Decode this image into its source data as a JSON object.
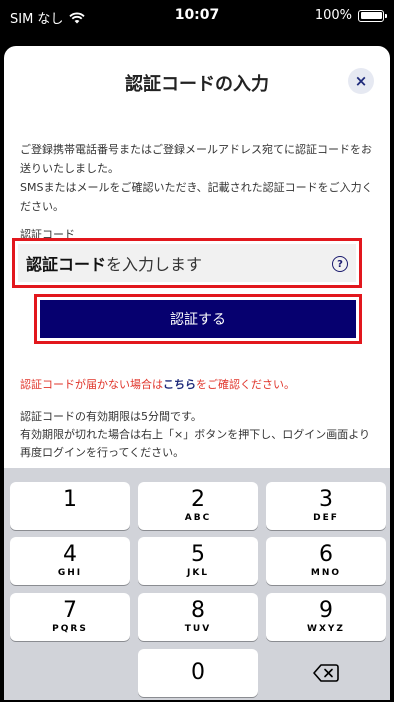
{
  "status_bar": {
    "carrier": "SIM なし",
    "time": "10:07",
    "battery": "100%"
  },
  "sheet": {
    "title": "認証コードの入力",
    "close_label": "×",
    "description_line1": "ご登録携帯電話番号またはご登録メールアドレス宛てに認証コードをお送りいたしました。",
    "description_line2": "SMSまたはメールをご確認いただき、記載された認証コードをご入力ください。",
    "field_label": "認証コード",
    "input_placeholder_bold": "認証コード",
    "input_placeholder_rest": "を入力します",
    "help_label": "?",
    "submit_label": "認証する",
    "not_arrived_prefix": "認証コードが届かない場合は",
    "not_arrived_link": "こちら",
    "not_arrived_suffix": "をご確認ください。",
    "validity_line1": "認証コードの有効期限は5分間です。",
    "validity_line2": "有効期限が切れた場合は右上「×」ボタンを押下し、ログイン画面より再度ログインを行ってください。"
  },
  "keypad": {
    "keys": [
      {
        "num": "1",
        "letters": ""
      },
      {
        "num": "2",
        "letters": "ABC"
      },
      {
        "num": "3",
        "letters": "DEF"
      },
      {
        "num": "4",
        "letters": "GHI"
      },
      {
        "num": "5",
        "letters": "JKL"
      },
      {
        "num": "6",
        "letters": "MNO"
      },
      {
        "num": "7",
        "letters": "PQRS"
      },
      {
        "num": "8",
        "letters": "TUV"
      },
      {
        "num": "9",
        "letters": "WXYZ"
      },
      {
        "num": "0",
        "letters": ""
      }
    ],
    "backspace_icon": "backspace-icon"
  },
  "colors": {
    "primary": "#06006f",
    "highlight_border": "#e2171d",
    "warning_text": "#e0352b"
  }
}
